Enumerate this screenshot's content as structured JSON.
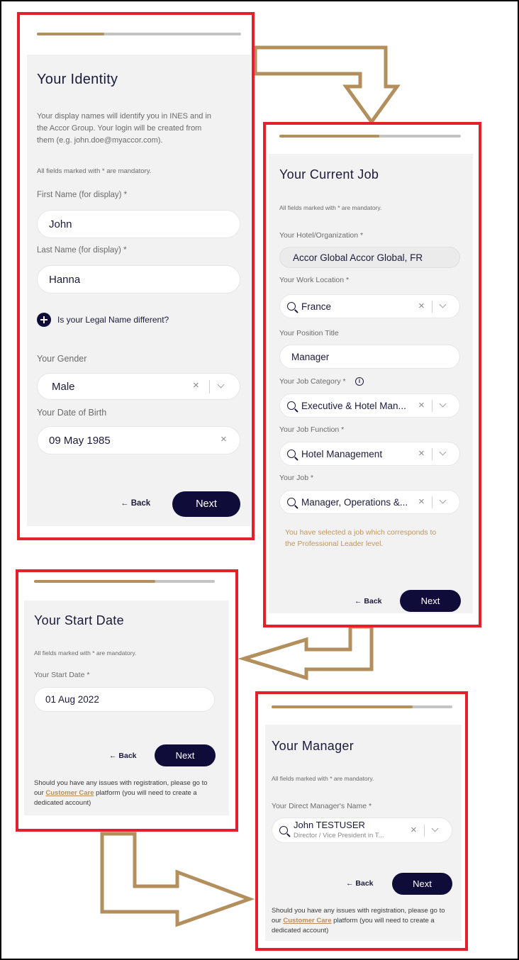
{
  "common": {
    "mandatory_note": "All fields marked with * are mandatory.",
    "back_label": "← Back",
    "next_label": "Next",
    "help_text_1": "Should you have any issues with registration, please go to",
    "help_text_2a": "our",
    "help_link": "Customer Care",
    "help_text_2b": "platform (you will need to create a",
    "help_text_3": "dedicated account)"
  },
  "identity": {
    "title": "Your Identity",
    "desc_1": "Your display names will identify you in INES and in",
    "desc_2": "the Accor Group. Your login will be created from",
    "desc_3": "them (e.g. john.doe@myaccor.com).",
    "first_name_label": "First Name (for display) *",
    "first_name_value": "John",
    "last_name_label": "Last Name (for display) *",
    "last_name_value": "Hanna",
    "legal_name_toggle": "Is your Legal Name different?",
    "gender_label": "Your Gender",
    "gender_value": "Male",
    "dob_label": "Your Date of Birth",
    "dob_value": "09 May 1985",
    "progress": 0.33
  },
  "current_job": {
    "title": "Your Current Job",
    "hotel_label": "Your Hotel/Organization *",
    "hotel_value": "Accor Global Accor Global, FR",
    "work_location_label": "Your Work Location *",
    "work_location_value": "France",
    "position_title_label": "Your Position Title",
    "position_title_value": "Manager",
    "job_category_label": "Your Job Category *",
    "job_category_value": "Executive & Hotel Man...",
    "job_function_label": "Your Job Function *",
    "job_function_value": "Hotel Management",
    "job_label": "Your Job *",
    "job_value": "Manager, Operations &...",
    "warning_1": "You have selected a job which corresponds to",
    "warning_2": "the Professional Leader level.",
    "progress": 0.55
  },
  "start_date": {
    "title": "Your Start Date",
    "start_date_label": "Your Start Date *",
    "start_date_value": "01 Aug 2022",
    "progress": 0.67
  },
  "manager": {
    "title": "Your Manager",
    "manager_label": "Your Direct Manager's Name *",
    "manager_name": "John TESTUSER",
    "manager_subtitle": "Director / Vice President in T...",
    "progress": 0.78
  },
  "colors": {
    "frame": "#e3202c",
    "accent": "#b38f5e",
    "button": "#0f0c3a",
    "arrow": "#b38f5e"
  }
}
